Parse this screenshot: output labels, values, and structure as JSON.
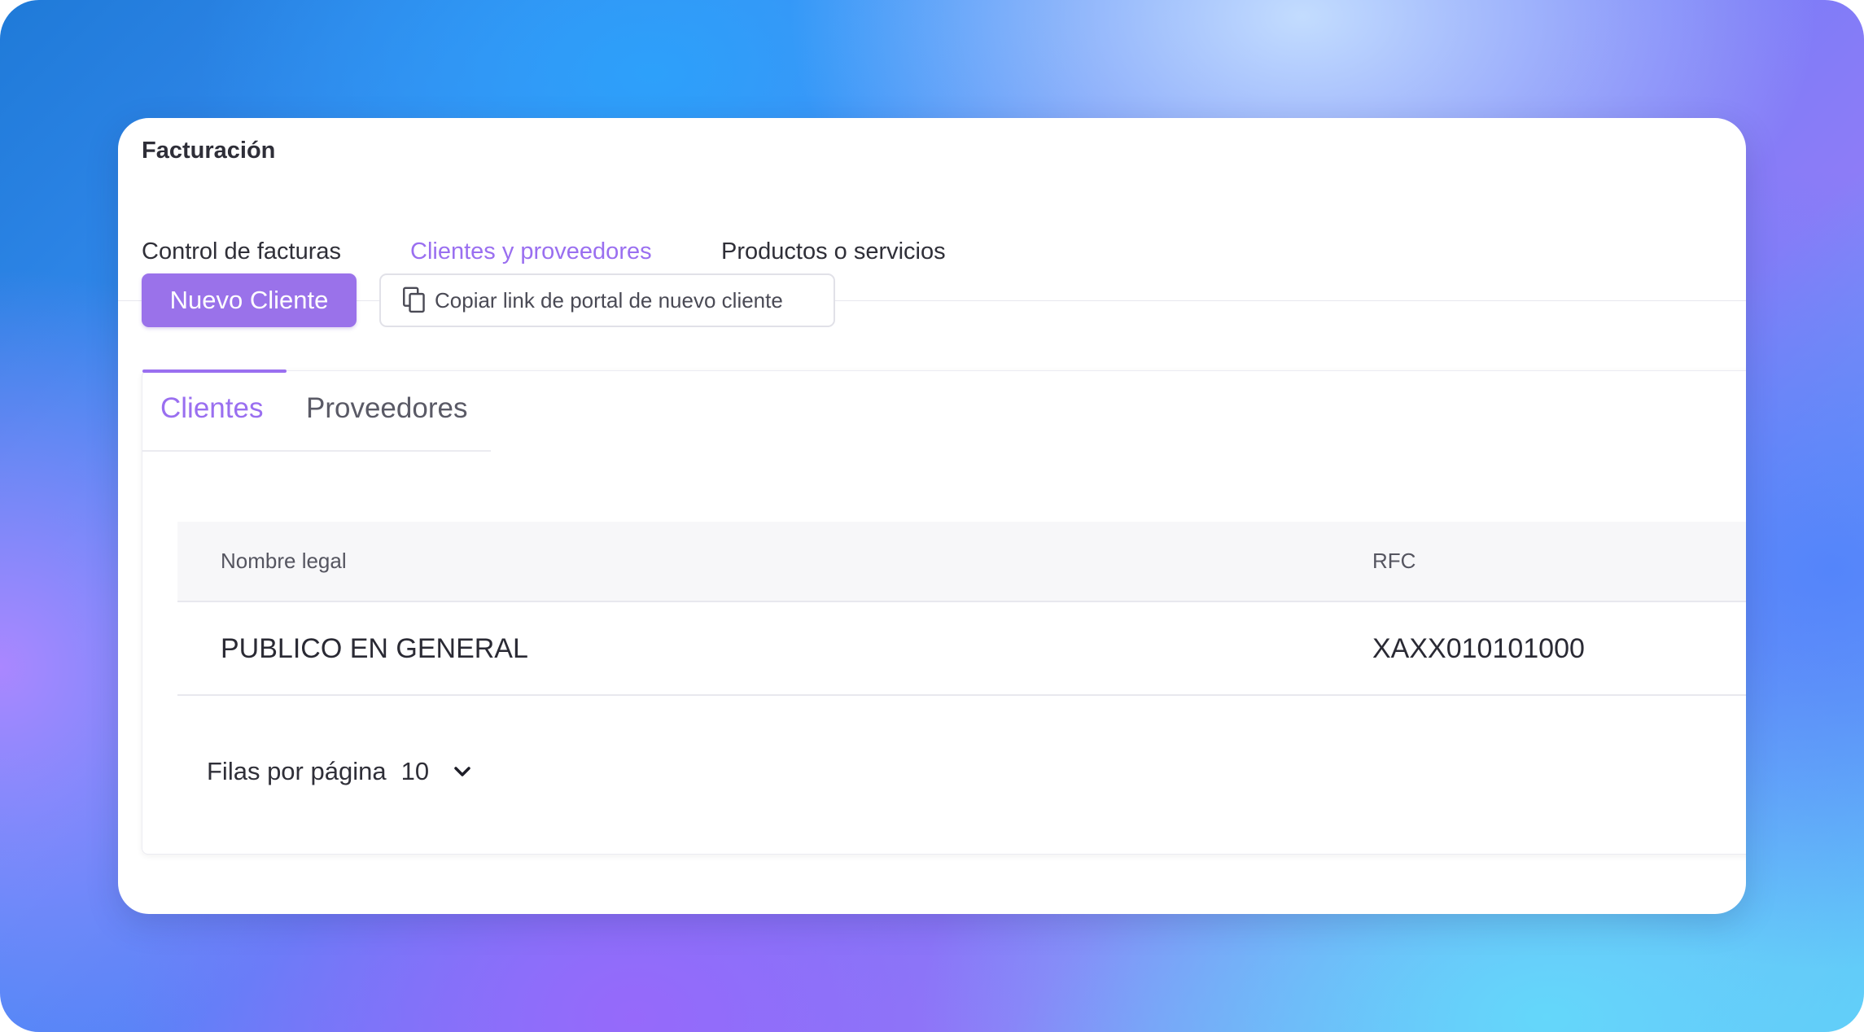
{
  "app": {
    "title": "Facturación"
  },
  "top_tabs": [
    {
      "label": "Control de facturas",
      "active": false
    },
    {
      "label": "Clientes y proveedores",
      "active": true
    },
    {
      "label": "Productos o servicios",
      "active": false
    }
  ],
  "actions": {
    "new_client_label": "Nuevo Cliente",
    "copy_link_label": "Copiar link de portal de nuevo cliente",
    "copy_link_icon": "copy-icon"
  },
  "sub_tabs": [
    {
      "label": "Clientes",
      "active": true
    },
    {
      "label": "Proveedores",
      "active": false
    }
  ],
  "table": {
    "columns": [
      "Nombre legal",
      "RFC"
    ],
    "rows": [
      [
        "PUBLICO EN GENERAL",
        "XAXX010101000"
      ]
    ]
  },
  "pagination": {
    "rows_per_page_label": "Filas por página",
    "rows_per_page_value": "10",
    "dropdown_icon": "chevron-down-icon"
  },
  "colors": {
    "accent": "#9a6ff0",
    "button_primary": "#9a72ea",
    "text": "#2f2f38"
  }
}
